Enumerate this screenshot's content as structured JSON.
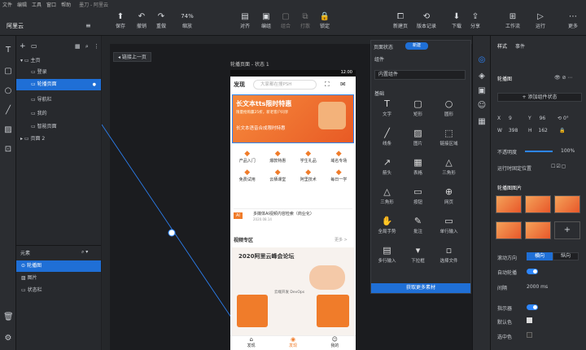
{
  "menu": [
    "文件",
    "编辑",
    "工具",
    "窗口",
    "帮助"
  ],
  "app_title": "墨刀 - 阿里云",
  "toolbar": {
    "save": "保存",
    "undo": "撤销",
    "redo": "重做",
    "zoom": "缩放",
    "zoom_value": "74%",
    "align": "对齐",
    "group": "编组",
    "ungroup": "组合",
    "flip": "打散",
    "lock": "锁定",
    "new_page": "新建页",
    "version": "版本记录",
    "download": "下载",
    "share": "分享",
    "workspace": "工作流",
    "run": "运行",
    "more": "更多"
  },
  "project_name": "阿里云",
  "pages": {
    "main": "主页",
    "items": [
      "登录",
      "轮播页面",
      "导航栏",
      "我的",
      "智能页面"
    ],
    "page2": "页面 2"
  },
  "elements": {
    "title": "元素",
    "items": [
      "轮播图",
      "图片",
      "状态栏"
    ]
  },
  "canvas": {
    "back": "链接上一页",
    "frame_label": "轮播页面 - 状态 1",
    "time": "12:00"
  },
  "phone": {
    "search_title": "发现",
    "search_placeholder": "大家都在搜PSH",
    "banner_title": "长文本tts限时特惠",
    "banner_sub": "限量抢购赢25折，新老客户同享",
    "banner_sub2": "长文本语音合成限时特惠",
    "icons_row1": [
      "产品入门",
      "爆款特惠",
      "学生礼品",
      "域名专场"
    ],
    "icons_row2": [
      "免费试用",
      "云栖课堂",
      "阿里技术",
      "每日一学"
    ],
    "news_tag": "AI",
    "news": "多媒体AI视频内容检索（商业化）",
    "news_date": "2020.08.14",
    "video_title": "视频专区",
    "video_more": "更多 >",
    "poster_title": "2020阿里云峰会论坛",
    "poster_sub": "云端开发 DevOps",
    "tabs": [
      "发现",
      "发现",
      "我的"
    ]
  },
  "widget": {
    "tab1": "页面状态",
    "tab2": "新建",
    "search": "组件",
    "dropdown": "内置组件",
    "section": "基础",
    "items": [
      "文字",
      "矩形",
      "圆形",
      "线条",
      "图片",
      "链接区域",
      "箭头",
      "表格",
      "三角形",
      "三角形",
      "按钮",
      "网页",
      "全局手势",
      "批注",
      "单行输入",
      "多行输入",
      "下拉框",
      "选择文件"
    ],
    "footer": "获取更多素材"
  },
  "props": {
    "tab1": "样式",
    "tab2": "事件",
    "name": "轮播图",
    "add_state": "+ 添加组件状态",
    "x": "9",
    "y": "96",
    "rot": "0°",
    "w": "398",
    "h": "162",
    "opacity_label": "不透明度",
    "opacity": "100%",
    "fixed_label": "运行时固定位置",
    "carousel": "轮播图图片",
    "direction_label": "滚动方向",
    "dir1": "横向",
    "dir2": "纵向",
    "autoplay": "自动轮播",
    "interval_label": "间隔",
    "interval": "2000 ms",
    "indicator": "指示器",
    "default_color": "默认色",
    "selected_color": "选中色"
  }
}
